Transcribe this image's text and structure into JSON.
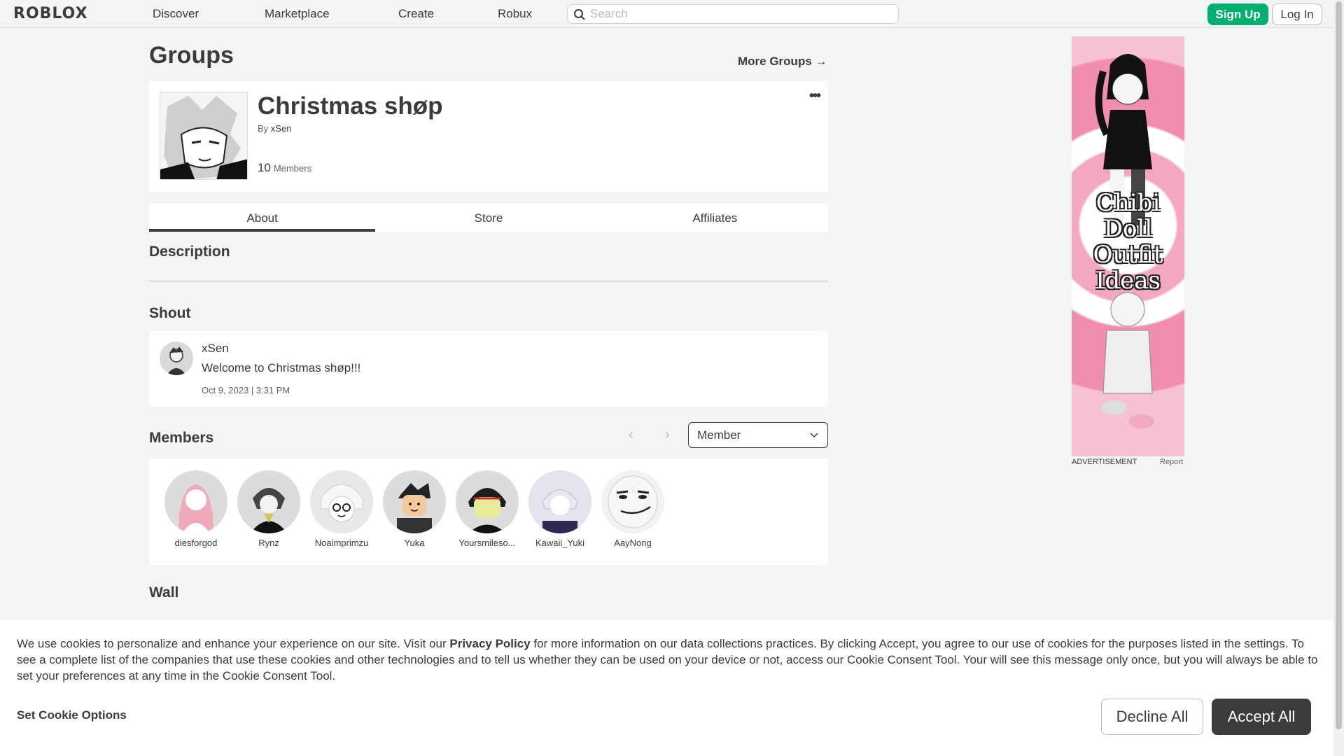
{
  "nav": {
    "logo": "ROBLOX",
    "links": [
      "Discover",
      "Marketplace",
      "Create",
      "Robux"
    ],
    "search_placeholder": "Search",
    "signup": "Sign Up",
    "login": "Log In"
  },
  "page": {
    "title": "Groups",
    "more_groups": "More Groups →"
  },
  "group": {
    "name": "Christmas shøp",
    "by_prefix": "By",
    "owner": "xSen",
    "member_count": "10",
    "member_label": "Members",
    "more_icon": "more-dots-icon"
  },
  "tabs": [
    "About",
    "Store",
    "Affiliates"
  ],
  "sections": {
    "description": "Description",
    "shout": "Shout",
    "members": "Members",
    "wall": "Wall"
  },
  "shout": {
    "user": "xSen",
    "text": "Welcome to Christmas shøp!!!",
    "date": "Oct 9, 2023 | 3:31 PM"
  },
  "members_filter": {
    "selected": "Member"
  },
  "members": [
    {
      "name": "diesforgod",
      "color": "#f0b8c4"
    },
    {
      "name": "Rynz",
      "color": "#5a5a5a"
    },
    {
      "name": "Noaimprimzu",
      "color": "#e6e6e6"
    },
    {
      "name": "Yuka",
      "color": "#3a3a3a"
    },
    {
      "name": "Yoursmileso...",
      "color": "#2b2b2b"
    },
    {
      "name": "Kawaii_Yuki",
      "color": "#d6d6e6"
    },
    {
      "name": "AayNong",
      "color": "#ececec"
    }
  ],
  "ad": {
    "headline": "Chibi Doll Outfit Ideas",
    "label": "ADVERTISEMENT",
    "report": "Report"
  },
  "cookie": {
    "text_before": "We use cookies to personalize and enhance your experience on our site. Visit our ",
    "policy_link": "Privacy Policy",
    "text_after": " for more information on our data collections practices. By clicking Accept, you agree to our use of cookies for the purposes listed in the settings. To see a complete list of the companies that use these cookies and other technologies and to tell us whether they can be used on your device or not, access our Cookie Consent Tool. Your will see this message only once, but you will always be able to set your preferences at any time in the Cookie Consent Tool.",
    "set_options": "Set Cookie Options",
    "decline": "Decline All",
    "accept": "Accept All"
  },
  "colors": {
    "accent_green": "#00b06f",
    "text_dark": "#393b3d",
    "bg": "#f2f4f5"
  }
}
